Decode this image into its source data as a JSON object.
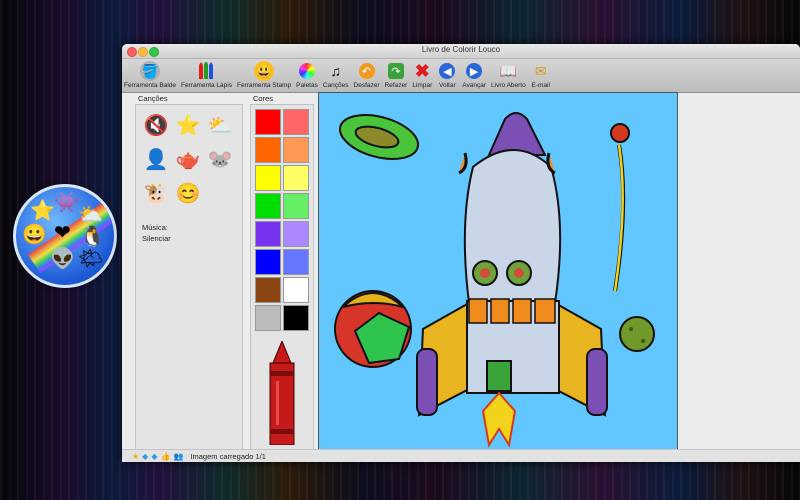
{
  "window": {
    "title": "Livro de Colorir Louco"
  },
  "toolbar": {
    "items": [
      {
        "label": "Ferramenta Balde",
        "icon": "paint-bucket-icon"
      },
      {
        "label": "Ferramenta Lápis",
        "icon": "pencils-icon"
      },
      {
        "label": "Ferramenta Stamp",
        "icon": "smiley-stamp-icon"
      },
      {
        "label": "Paletas",
        "icon": "color-wheel-icon"
      },
      {
        "label": "Canções",
        "icon": "music-note-icon"
      },
      {
        "label": "Desfazer",
        "icon": "undo-icon"
      },
      {
        "label": "Refazer",
        "icon": "redo-icon"
      },
      {
        "label": "Limpar",
        "icon": "clear-x-icon"
      },
      {
        "label": "Voltar",
        "icon": "back-arrow-icon"
      },
      {
        "label": "Avançar",
        "icon": "forward-arrow-icon"
      },
      {
        "label": "Livro Aberto",
        "icon": "open-book-icon"
      },
      {
        "label": "E-mail",
        "icon": "email-icon"
      }
    ]
  },
  "songs": {
    "label": "Canções",
    "icons": [
      "mute-icon",
      "star-icon",
      "sun-cloud-icon",
      "person-icon",
      "teapot-icon",
      "mouse-icon",
      "cow-icon",
      "smiley-icon"
    ],
    "music_label": "Música:",
    "music_value": "Silenciar"
  },
  "colors": {
    "label": "Cores",
    "swatches": [
      "#ff0000",
      "#ff6666",
      "#ff6600",
      "#ff9955",
      "#ffff00",
      "#ffff66",
      "#00dd00",
      "#66ee66",
      "#7733ee",
      "#aa88ff",
      "#0000ff",
      "#6677ff",
      "#8b4513",
      "#ffffff",
      "#bbbbbb",
      "#000000"
    ]
  },
  "canvas": {
    "background": "#62c6ff"
  },
  "status": {
    "icons": [
      "star-icon",
      "twitter-bird-icon",
      "twitter-bird-icon",
      "thumbs-up-icon",
      "people-icon"
    ],
    "text": "Imagem carregado 1/1"
  }
}
